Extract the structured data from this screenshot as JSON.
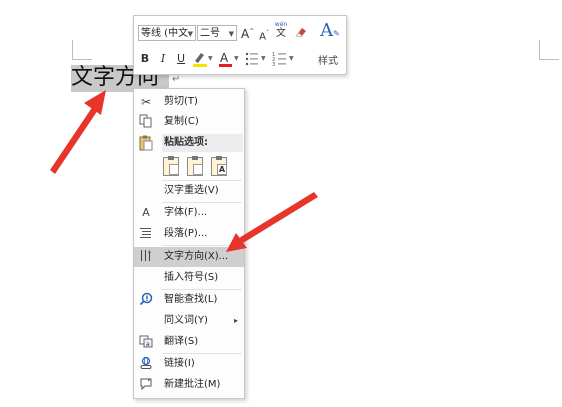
{
  "document": {
    "text": "文字方向",
    "paragraph_mark": "↵"
  },
  "mini_toolbar": {
    "font_name": "等线 (中文",
    "font_size": "二号",
    "grow_font": "A",
    "shrink_font": "A",
    "phonetic": "wén",
    "phonetic_char": "文",
    "bold": "B",
    "italic": "I",
    "underline": "U",
    "font_color": "A",
    "styles_label": "样式"
  },
  "context_menu": {
    "items": [
      {
        "label": "剪切(T)",
        "icon": "scissors-icon"
      },
      {
        "label": "复制(C)",
        "icon": "copy-icon"
      },
      {
        "label": "粘贴选项:",
        "icon": "paste-icon"
      },
      {
        "label": "汉字重选(V)"
      },
      {
        "label": "字体(F)...",
        "icon": "font-icon"
      },
      {
        "label": "段落(P)...",
        "icon": "paragraph-icon"
      },
      {
        "label": "文字方向(X)...",
        "icon": "text-direction-icon"
      },
      {
        "label": "插入符号(S)"
      },
      {
        "label": "智能查找(L)",
        "icon": "smart-lookup-icon"
      },
      {
        "label": "同义词(Y)",
        "submenu": "▸"
      },
      {
        "label": "翻译(S)",
        "icon": "translate-icon"
      },
      {
        "label": "链接(I)",
        "icon": "link-icon"
      },
      {
        "label": "新建批注(M)",
        "icon": "new-comment-icon"
      }
    ],
    "paste_letter": "A"
  },
  "colors": {
    "highlight": "#cfcfcf",
    "selection": "#c9c9c9",
    "arrow": "#e8352b",
    "font_color_bar": "#e02020",
    "highlight_bar": "#f5e400"
  }
}
